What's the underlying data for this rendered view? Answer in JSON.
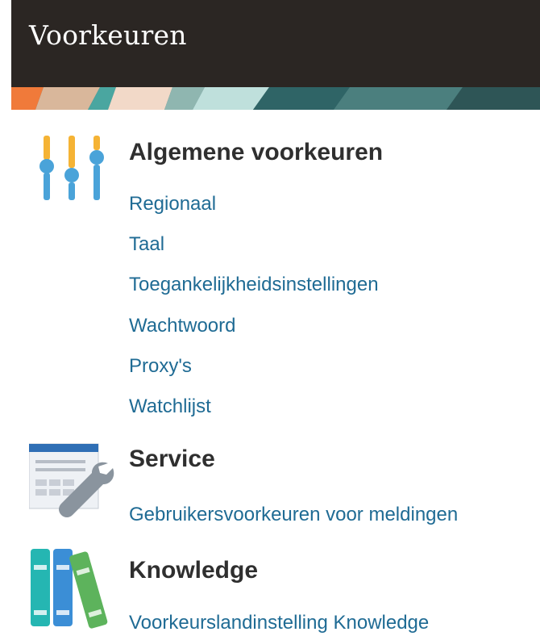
{
  "header": {
    "title": "Voorkeuren"
  },
  "sections": [
    {
      "title": "Algemene voorkeuren",
      "icon": "sliders-icon",
      "links": [
        "Regionaal",
        "Taal",
        "Toegankelijkheidsinstellingen",
        "Wachtwoord",
        "Proxy's",
        "Watchlijst"
      ]
    },
    {
      "title": "Service",
      "icon": "service-wrench-icon",
      "links": [
        "Gebruikersvoorkeuren voor meldingen"
      ]
    },
    {
      "title": "Knowledge",
      "icon": "books-icon",
      "links": [
        "Voorkeurslandinstelling Knowledge"
      ]
    }
  ],
  "colors": {
    "header_bg": "#2b2623",
    "link": "#1f6b94",
    "slider_track": "#4aa3d9",
    "slider_knob": "#4aa3d9",
    "slider_accent": "#f5b335"
  }
}
